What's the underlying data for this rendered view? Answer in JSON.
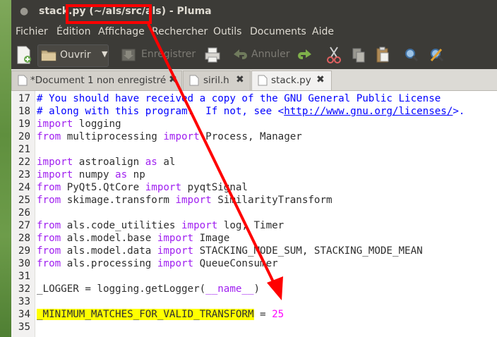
{
  "window": {
    "title": "stack.py (~/als/src/als) - Pluma"
  },
  "menu": [
    "Fichier",
    "Édition",
    "Affichage",
    "Rechercher",
    "Outils",
    "Documents",
    "Aide"
  ],
  "toolbar": {
    "open_label": "Ouvrir",
    "save_label": "Enregistrer",
    "undo_label": "Annuler"
  },
  "tabs": [
    {
      "label": "*Document 1 non enregistré",
      "active": false
    },
    {
      "label": "siril.h",
      "active": false
    },
    {
      "label": "stack.py",
      "active": true
    }
  ],
  "editor": {
    "first_line": 17,
    "lines": [
      [
        {
          "t": "# You should have received a copy of the GNU General Public License",
          "c": "cm"
        }
      ],
      [
        {
          "t": "# along with this program.  If not, see <",
          "c": "cm"
        },
        {
          "t": "http://www.gnu.org/licenses/",
          "c": "cm ul"
        },
        {
          "t": ">.",
          "c": "cm"
        }
      ],
      [
        {
          "t": "import",
          "c": "kw"
        },
        {
          "t": " logging"
        }
      ],
      [
        {
          "t": "from",
          "c": "kw"
        },
        {
          "t": " multiprocessing "
        },
        {
          "t": "import",
          "c": "kw"
        },
        {
          "t": " Process, Manager"
        }
      ],
      [],
      [
        {
          "t": "import",
          "c": "kw"
        },
        {
          "t": " astroalign "
        },
        {
          "t": "as",
          "c": "kw"
        },
        {
          "t": " al"
        }
      ],
      [
        {
          "t": "import",
          "c": "kw"
        },
        {
          "t": " numpy "
        },
        {
          "t": "as",
          "c": "kw"
        },
        {
          "t": " np"
        }
      ],
      [
        {
          "t": "from",
          "c": "kw"
        },
        {
          "t": " PyQt5.QtCore "
        },
        {
          "t": "import",
          "c": "kw"
        },
        {
          "t": " pyqtSignal"
        }
      ],
      [
        {
          "t": "from",
          "c": "kw"
        },
        {
          "t": " skimage.transform "
        },
        {
          "t": "import",
          "c": "kw"
        },
        {
          "t": " SimilarityTransform"
        }
      ],
      [],
      [
        {
          "t": "from",
          "c": "kw"
        },
        {
          "t": " als.code_utilities "
        },
        {
          "t": "import",
          "c": "kw"
        },
        {
          "t": " log, Timer"
        }
      ],
      [
        {
          "t": "from",
          "c": "kw"
        },
        {
          "t": " als.model.base "
        },
        {
          "t": "import",
          "c": "kw"
        },
        {
          "t": " Image"
        }
      ],
      [
        {
          "t": "from",
          "c": "kw"
        },
        {
          "t": " als.model.data "
        },
        {
          "t": "import",
          "c": "kw"
        },
        {
          "t": " STACKING_MODE_SUM, STACKING_MODE_MEAN"
        }
      ],
      [
        {
          "t": "from",
          "c": "kw"
        },
        {
          "t": " als.processing "
        },
        {
          "t": "import",
          "c": "kw"
        },
        {
          "t": " QueueConsumer"
        }
      ],
      [],
      [
        {
          "t": "_LOGGER = logging.getLogger("
        },
        {
          "t": "__name__",
          "c": "kw"
        },
        {
          "t": ")"
        }
      ],
      [],
      [
        {
          "t": "_MINIMUM_MATCHES_FOR_VALID_TRANSFORM",
          "c": "hl"
        },
        {
          "t": " = "
        },
        {
          "t": "25",
          "c": "num"
        }
      ],
      []
    ]
  },
  "colors": {
    "annotation": "#ff0000",
    "highlight": "#ffff00"
  }
}
